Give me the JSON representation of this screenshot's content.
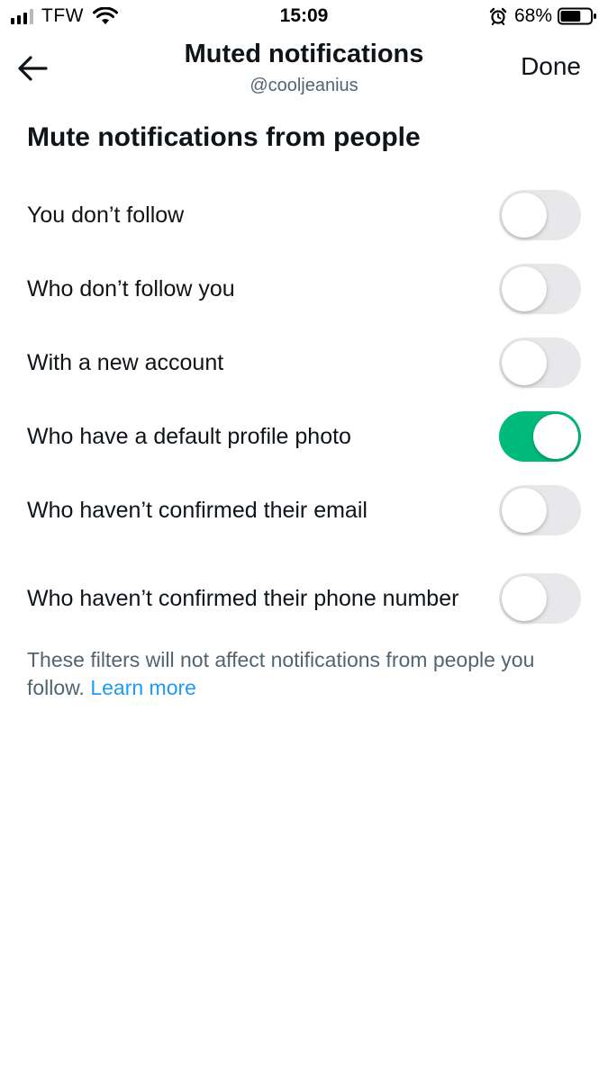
{
  "status_bar": {
    "carrier": "TFW",
    "time": "15:09",
    "battery_percent": "68%",
    "signal_bars": 4,
    "signal_bars_filled": 3,
    "battery_level": 0.68,
    "icons": [
      "signal-icon",
      "wifi-icon",
      "alarm-icon",
      "battery-icon"
    ]
  },
  "header": {
    "title": "Muted notifications",
    "subtitle": "@cooljeanius",
    "done_label": "Done",
    "back_icon": "arrow-left-icon"
  },
  "section": {
    "title": "Mute notifications from people"
  },
  "settings": [
    {
      "label": "You don’t follow",
      "on": false
    },
    {
      "label": "Who don’t follow you",
      "on": false
    },
    {
      "label": "With a new account",
      "on": false
    },
    {
      "label": "Who have a default profile photo",
      "on": true
    },
    {
      "label": "Who haven’t confirmed their email",
      "on": false
    },
    {
      "label": "Who haven’t confirmed their phone number",
      "on": false
    }
  ],
  "footnote": {
    "text": "These filters will not affect notifications from people you follow.",
    "link_label": "Learn more"
  },
  "colors": {
    "toggle_on": "#00ba7c",
    "toggle_off": "#e8e8eb",
    "link": "#1d9bf0",
    "secondary_text": "#536471",
    "primary_text": "#0f1419"
  }
}
